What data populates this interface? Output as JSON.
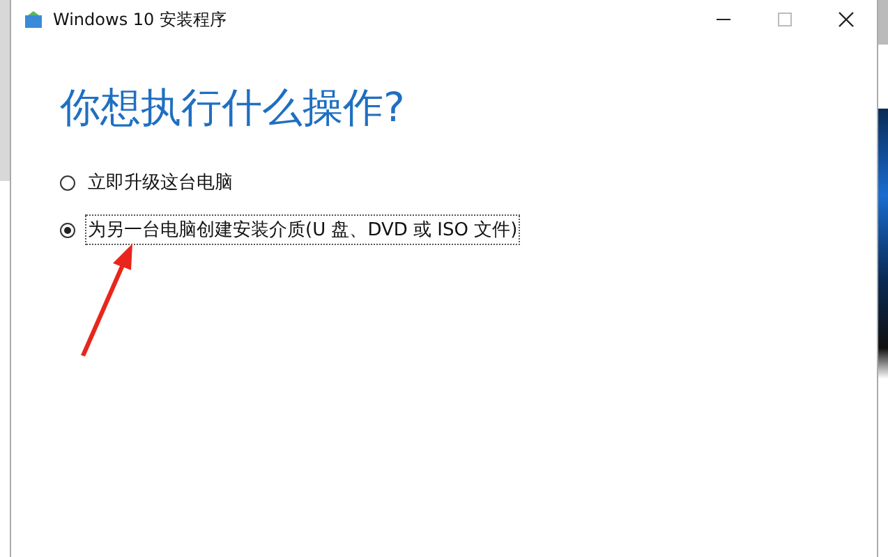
{
  "window": {
    "title": "Windows 10 安装程序"
  },
  "heading": "你想执行什么操作?",
  "options": [
    {
      "label": "立即升级这台电脑",
      "selected": false,
      "focused": false
    },
    {
      "label": "为另一台电脑创建安装介质(U 盘、DVD 或 ISO 文件)",
      "selected": true,
      "focused": true
    }
  ]
}
